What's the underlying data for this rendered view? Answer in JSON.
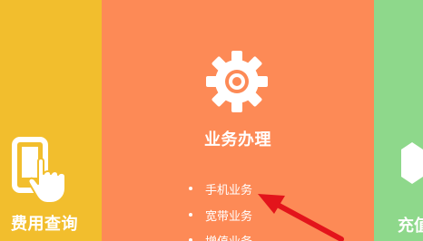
{
  "panels": {
    "left": {
      "title": "费用查询",
      "icon": "phone-touch-icon",
      "color": "#f2be2d"
    },
    "center": {
      "title": "业务办理",
      "icon": "gear-icon",
      "color": "#fd8a56",
      "menu": [
        {
          "label": "手机业务"
        },
        {
          "label": "宽带业务"
        },
        {
          "label": "增值业务"
        }
      ]
    },
    "right": {
      "title": "充值",
      "icon": "hexagon-icon",
      "color": "#8ed88b"
    }
  },
  "annotation": {
    "icon": "red-arrow-icon",
    "color": "#e3141b"
  }
}
